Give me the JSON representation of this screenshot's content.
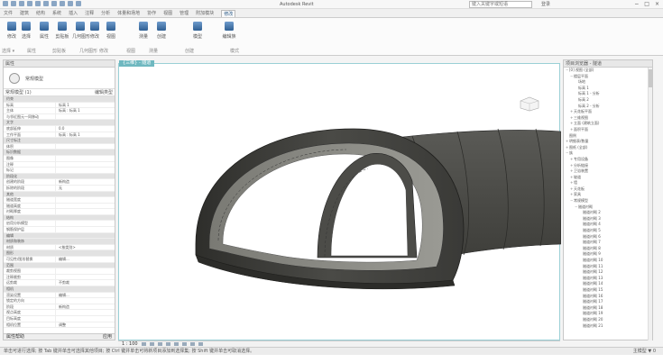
{
  "app": {
    "title": "Autodesk Revit",
    "search_placeholder": "键入关键字或短语",
    "user": "登录",
    "window_controls": [
      "−",
      "□",
      "×"
    ]
  },
  "ribbon": {
    "tabs": [
      "文件",
      "建筑",
      "结构",
      "系统",
      "插入",
      "注释",
      "分析",
      "体量和场地",
      "协作",
      "视图",
      "管理",
      "附加模块",
      "修改"
    ],
    "active_tab_index": 12,
    "tools": [
      {
        "label": "修改",
        "icon": "cursor-icon"
      },
      {
        "label": "选择",
        "icon": "select-icon"
      },
      {
        "label": "属性",
        "icon": "properties-icon"
      },
      {
        "label": "剪贴板",
        "icon": "clipboard-icon"
      },
      {
        "label": "几何图形",
        "icon": "geometry-icon"
      },
      {
        "label": "修改",
        "icon": "modify-icon"
      },
      {
        "label": "视图",
        "icon": "view-icon"
      },
      {
        "label": "测量",
        "icon": "measure-icon"
      },
      {
        "label": "创建",
        "icon": "create-icon"
      },
      {
        "label": "模型",
        "icon": "model-icon"
      },
      {
        "label": "编辑族",
        "icon": "edit-family-icon"
      }
    ],
    "groups": [
      "选择 ▾",
      "属性",
      "剪贴板",
      "几何图形",
      "修改",
      "视图",
      "测量",
      "创建",
      "模式"
    ]
  },
  "properties": {
    "header": "属性",
    "type_name": "常规模型",
    "instance_label": "常规模型 (1)",
    "edit_type": "编辑类型",
    "rows": [
      {
        "k": "约束",
        "v": "",
        "section": true
      },
      {
        "k": "标高",
        "v": "标高 1"
      },
      {
        "k": "主体",
        "v": "标高 : 标高 1"
      },
      {
        "k": "与邻近图元一同移动",
        "v": ""
      },
      {
        "k": "文字",
        "v": "",
        "section": true
      },
      {
        "k": "底部延伸",
        "v": "0.0"
      },
      {
        "k": "工作平面",
        "v": "标高 : 标高 1"
      },
      {
        "k": "尺寸标注",
        "v": "",
        "section": true
      },
      {
        "k": "体积",
        "v": ""
      },
      {
        "k": "标识数据",
        "v": "",
        "section": true
      },
      {
        "k": "图像",
        "v": ""
      },
      {
        "k": "注释",
        "v": ""
      },
      {
        "k": "标记",
        "v": ""
      },
      {
        "k": "阶段化",
        "v": "",
        "section": true
      },
      {
        "k": "创建的阶段",
        "v": "新构造"
      },
      {
        "k": "拆除的阶段",
        "v": "无"
      },
      {
        "k": "其他",
        "v": "",
        "section": true
      },
      {
        "k": "隧道宽度",
        "v": ""
      },
      {
        "k": "隧道高度",
        "v": ""
      },
      {
        "k": "衬砌厚度",
        "v": ""
      },
      {
        "k": "结构",
        "v": "",
        "section": true
      },
      {
        "k": "启用分析模型",
        "v": ""
      },
      {
        "k": "钢筋保护层",
        "v": ""
      },
      {
        "k": "编辑",
        "v": "",
        "section": true
      },
      {
        "k": "材质和装饰",
        "v": "",
        "section": true
      },
      {
        "k": "材质",
        "v": "<按类别>"
      },
      {
        "k": "图形",
        "v": "",
        "section": true
      },
      {
        "k": "可见性/图形替换",
        "v": "编辑..."
      },
      {
        "k": "范围",
        "v": "",
        "section": true
      },
      {
        "k": "裁剪视图",
        "v": ""
      },
      {
        "k": "注释裁剪",
        "v": ""
      },
      {
        "k": "远剪裁",
        "v": "不剪裁"
      },
      {
        "k": "相机",
        "v": "",
        "section": true
      },
      {
        "k": "渲染设置",
        "v": "编辑..."
      },
      {
        "k": "锁定的方向",
        "v": ""
      },
      {
        "k": "阶段",
        "v": "新构造"
      },
      {
        "k": "视点高度",
        "v": ""
      },
      {
        "k": "目标高度",
        "v": ""
      },
      {
        "k": "相机位置",
        "v": "调整"
      }
    ],
    "help_link": "属性帮助",
    "apply_label": "应用"
  },
  "viewport": {
    "tab_label": "{三维} - 隧道",
    "scale": "1 : 100"
  },
  "browser": {
    "header": "项目浏览器 - 隧道",
    "items": [
      {
        "indent": 0,
        "tw": "−",
        "label": "[0] 视图 (全部)"
      },
      {
        "indent": 1,
        "tw": "−",
        "label": "楼层平面"
      },
      {
        "indent": 2,
        "tw": "",
        "label": "场地"
      },
      {
        "indent": 2,
        "tw": "",
        "label": "标高 1"
      },
      {
        "indent": 2,
        "tw": "",
        "label": "标高 1 - 分析"
      },
      {
        "indent": 2,
        "tw": "",
        "label": "标高 2"
      },
      {
        "indent": 2,
        "tw": "",
        "label": "标高 2 - 分析"
      },
      {
        "indent": 1,
        "tw": "+",
        "label": "天花板平面"
      },
      {
        "indent": 1,
        "tw": "+",
        "label": "三维视图"
      },
      {
        "indent": 1,
        "tw": "+",
        "label": "立面 (建筑立面)"
      },
      {
        "indent": 1,
        "tw": "+",
        "label": "面积平面"
      },
      {
        "indent": 0,
        "tw": "",
        "label": "图例"
      },
      {
        "indent": 0,
        "tw": "+",
        "label": "明细表/数量"
      },
      {
        "indent": 0,
        "tw": "+",
        "label": "图纸 (全部)"
      },
      {
        "indent": 0,
        "tw": "−",
        "label": "族"
      },
      {
        "indent": 1,
        "tw": "+",
        "label": "专用设备"
      },
      {
        "indent": 1,
        "tw": "+",
        "label": "分析链接"
      },
      {
        "indent": 1,
        "tw": "+",
        "label": "卫浴装置"
      },
      {
        "indent": 1,
        "tw": "+",
        "label": "坡道"
      },
      {
        "indent": 1,
        "tw": "+",
        "label": "墙"
      },
      {
        "indent": 1,
        "tw": "+",
        "label": "天花板"
      },
      {
        "indent": 1,
        "tw": "+",
        "label": "家具"
      },
      {
        "indent": 1,
        "tw": "−",
        "label": "常规模型"
      },
      {
        "indent": 2,
        "tw": "−",
        "label": "隧道衬砌"
      },
      {
        "indent": 3,
        "tw": "",
        "label": "隧道衬砌 2"
      },
      {
        "indent": 3,
        "tw": "",
        "label": "隧道衬砌 3"
      },
      {
        "indent": 3,
        "tw": "",
        "label": "隧道衬砌 4"
      },
      {
        "indent": 3,
        "tw": "",
        "label": "隧道衬砌 5"
      },
      {
        "indent": 3,
        "tw": "",
        "label": "隧道衬砌 6"
      },
      {
        "indent": 3,
        "tw": "",
        "label": "隧道衬砌 7"
      },
      {
        "indent": 3,
        "tw": "",
        "label": "隧道衬砌 8"
      },
      {
        "indent": 3,
        "tw": "",
        "label": "隧道衬砌 9"
      },
      {
        "indent": 3,
        "tw": "",
        "label": "隧道衬砌 10"
      },
      {
        "indent": 3,
        "tw": "",
        "label": "隧道衬砌 11"
      },
      {
        "indent": 3,
        "tw": "",
        "label": "隧道衬砌 12"
      },
      {
        "indent": 3,
        "tw": "",
        "label": "隧道衬砌 13"
      },
      {
        "indent": 3,
        "tw": "",
        "label": "隧道衬砌 14"
      },
      {
        "indent": 3,
        "tw": "",
        "label": "隧道衬砌 15"
      },
      {
        "indent": 3,
        "tw": "",
        "label": "隧道衬砌 16"
      },
      {
        "indent": 3,
        "tw": "",
        "label": "隧道衬砌 17"
      },
      {
        "indent": 3,
        "tw": "",
        "label": "隧道衬砌 18"
      },
      {
        "indent": 3,
        "tw": "",
        "label": "隧道衬砌 19"
      },
      {
        "indent": 3,
        "tw": "",
        "label": "隧道衬砌 20"
      },
      {
        "indent": 3,
        "tw": "",
        "label": "隧道衬砌 21"
      }
    ]
  },
  "statusbar": {
    "text": "单击可进行选择; 按 Tab 键并单击可选择其他项目; 按 Ctrl 键并单击可将新项目添加到选择集; 按 Shift 键并单击可取消选择。",
    "model": "主模型",
    "filter": "0"
  },
  "colors": {
    "tunnel_dark": "#3b3b38",
    "tunnel_mid": "#5c5c58",
    "tunnel_light": "#8a8a85",
    "accent": "#6fb8c0"
  }
}
